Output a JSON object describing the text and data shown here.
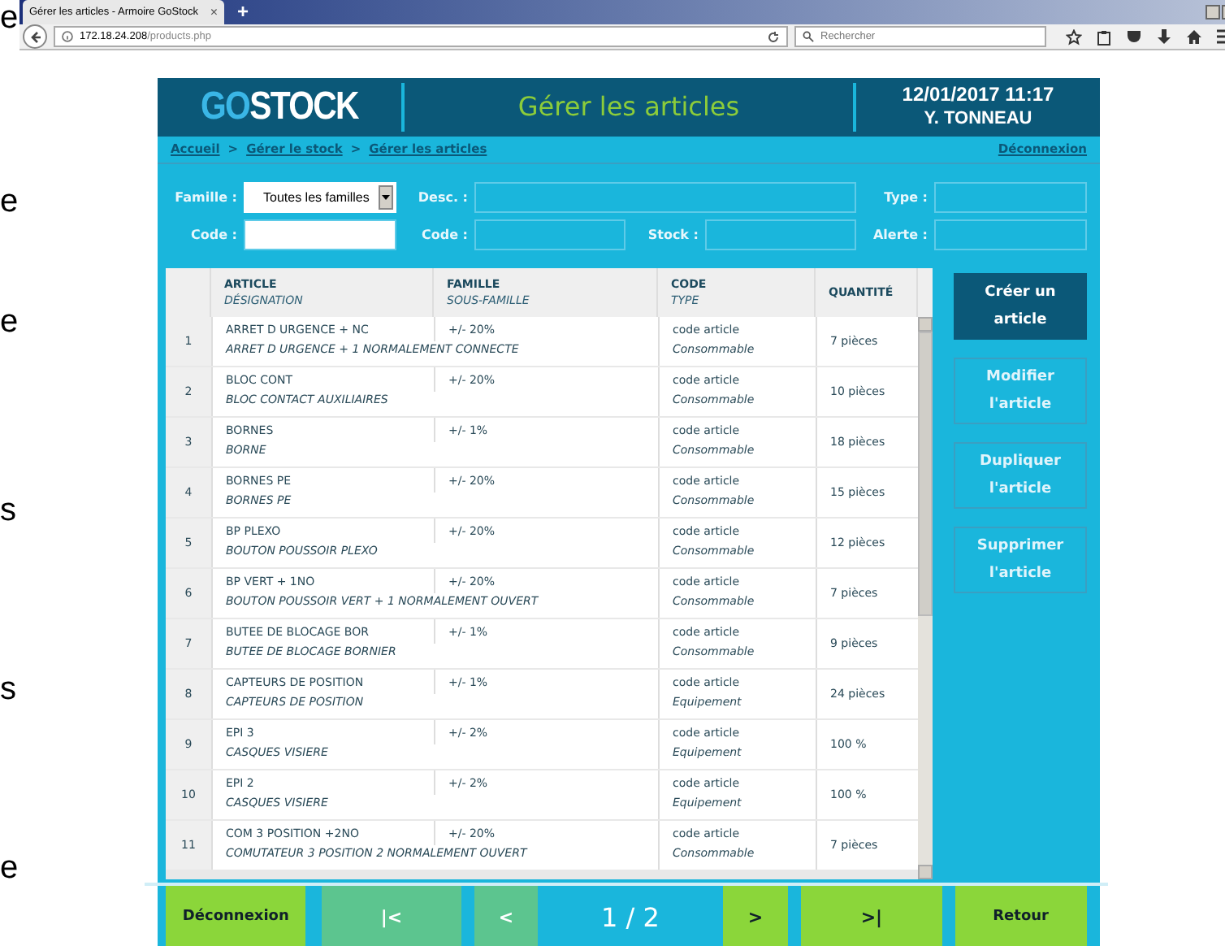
{
  "background_letters": [
    "e",
    "e",
    "e",
    "s",
    "s",
    "e"
  ],
  "browser": {
    "tab_title": "Gérer les articles - Armoire GoStock",
    "tab_close": "×",
    "new_tab": "+",
    "url_host": "172.18.24.208",
    "url_path": "/products.php",
    "search_placeholder": "Rechercher"
  },
  "header": {
    "logo_a": "GO",
    "logo_b": "STOCK",
    "title": "Gérer les articles",
    "datetime": "12/01/2017 11:17",
    "user": "Y. TONNEAU"
  },
  "breadcrumb": {
    "items": [
      "Accueil",
      "Gérer le stock",
      "Gérer les articles"
    ],
    "separator": ">",
    "logout": "Déconnexion"
  },
  "filters": [
    {
      "label": "Famille :",
      "kind": "select",
      "value": "Toutes les familles"
    },
    {
      "label": "Desc. :",
      "kind": "wide"
    },
    {
      "label": "Type :",
      "kind": "text"
    },
    {
      "label": "Code :",
      "kind": "text"
    },
    {
      "label": "Code :",
      "kind": "text"
    },
    {
      "label": "Stock :",
      "kind": "text"
    },
    {
      "label": "Alerte :",
      "kind": "text"
    }
  ],
  "table": {
    "columns": [
      {
        "title": "ARTICLE",
        "subtitle": "DÉSIGNATION"
      },
      {
        "title": "FAMILLE",
        "subtitle": "SOUS-FAMILLE"
      },
      {
        "title": "CODE",
        "subtitle": "TYPE"
      },
      {
        "title": "QUANTITÉ"
      }
    ],
    "rows": [
      {
        "number": "1",
        "article": "ARRET D URGENCE + NC",
        "designation": "ARRET D URGENCE + 1 NORMALEMENT CONNECTE",
        "famille": "+/- 20%",
        "code": "code article",
        "type": "Consommable",
        "quantity": "7 pièces"
      },
      {
        "number": "2",
        "article": "BLOC CONT",
        "designation": "BLOC CONTACT AUXILIAIRES",
        "famille": "+/- 20%",
        "code": "code article",
        "type": "Consommable",
        "quantity": "10 pièces"
      },
      {
        "number": "3",
        "article": "BORNES",
        "designation": "BORNE",
        "famille": "+/- 1%",
        "code": "code article",
        "type": "Consommable",
        "quantity": "18 pièces"
      },
      {
        "number": "4",
        "article": "BORNES PE",
        "designation": "BORNES PE",
        "famille": "+/- 20%",
        "code": "code article",
        "type": "Consommable",
        "quantity": "15 pièces"
      },
      {
        "number": "5",
        "article": "BP PLEXO",
        "designation": "BOUTON POUSSOIR PLEXO",
        "famille": "+/- 20%",
        "code": "code article",
        "type": "Consommable",
        "quantity": "12 pièces"
      },
      {
        "number": "6",
        "article": "BP VERT + 1NO",
        "designation": "BOUTON POUSSOIR VERT + 1 NORMALEMENT OUVERT",
        "famille": "+/- 20%",
        "code": "code article",
        "type": "Consommable",
        "quantity": "7 pièces"
      },
      {
        "number": "7",
        "article": "BUTEE DE BLOCAGE BOR",
        "designation": "BUTEE DE BLOCAGE BORNIER",
        "famille": "+/- 1%",
        "code": "code article",
        "type": "Consommable",
        "quantity": "9 pièces"
      },
      {
        "number": "8",
        "article": "CAPTEURS DE POSITION",
        "designation": "CAPTEURS DE POSITION",
        "famille": "+/- 1%",
        "code": "code article",
        "type": "Equipement",
        "quantity": "24 pièces"
      },
      {
        "number": "9",
        "article": "EPI 3",
        "designation": "CASQUES VISIERE",
        "famille": "+/- 2%",
        "code": "code article",
        "type": "Equipement",
        "quantity": "100 %"
      },
      {
        "number": "10",
        "article": "EPI 2",
        "designation": "CASQUES VISIERE",
        "famille": "+/- 2%",
        "code": "code article",
        "type": "Equipement",
        "quantity": "100 %"
      },
      {
        "number": "11",
        "article": "COM 3 POSITION +2NO",
        "designation": "COMUTATEUR 3 POSITION 2 NORMALEMENT OUVERT",
        "famille": "+/- 20%",
        "code": "code article",
        "type": "Consommable",
        "quantity": "7 pièces"
      }
    ]
  },
  "actions": [
    {
      "label": "Créer un article",
      "kind": "primary"
    },
    {
      "label": "Modifier l'article",
      "kind": "secondary"
    },
    {
      "label": "Dupliquer l'article",
      "kind": "secondary"
    },
    {
      "label": "Supprimer l'article",
      "kind": "secondary"
    }
  ],
  "footer": {
    "logout": "Déconnexion",
    "first": {
      "label": "|<",
      "disabled": true
    },
    "previous": {
      "label": "<",
      "disabled": true
    },
    "page": "1 / 2",
    "next": {
      "label": ">",
      "disabled": false
    },
    "last": {
      "label": ">|",
      "disabled": false
    },
    "back": "Retour"
  }
}
